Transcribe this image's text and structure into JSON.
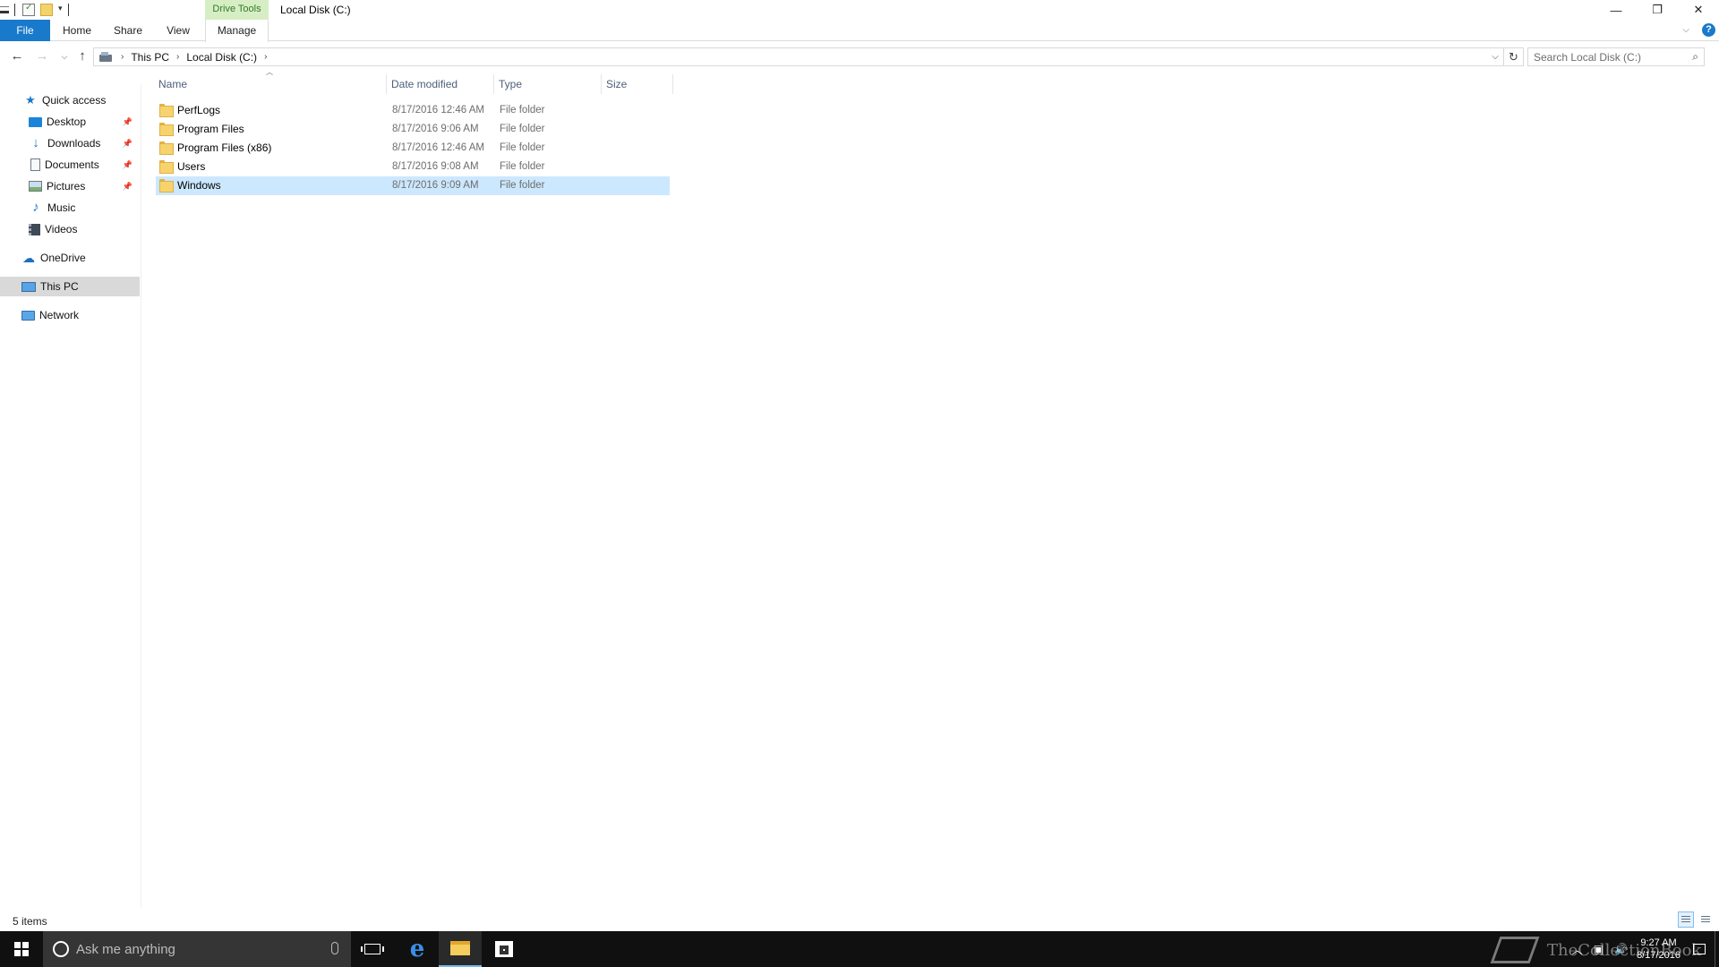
{
  "window": {
    "title": "Local Disk (C:)",
    "context_tab": "Drive Tools",
    "buttons": {
      "minimize": "—",
      "restore": "❐",
      "close": "✕"
    }
  },
  "ribbon": {
    "tabs": [
      "File",
      "Home",
      "Share",
      "View",
      "Manage"
    ],
    "help": "?"
  },
  "address": {
    "breadcrumbs": [
      "This PC",
      "Local Disk (C:)"
    ],
    "search_placeholder": "Search Local Disk (C:)"
  },
  "nav": {
    "quick_access": "Quick access",
    "items": [
      {
        "label": "Desktop",
        "icon": "desktop-icon",
        "pinned": true
      },
      {
        "label": "Downloads",
        "icon": "downloads-icon",
        "pinned": true
      },
      {
        "label": "Documents",
        "icon": "documents-icon",
        "pinned": true
      },
      {
        "label": "Pictures",
        "icon": "pictures-icon",
        "pinned": true
      },
      {
        "label": "Music",
        "icon": "music-icon",
        "pinned": false
      },
      {
        "label": "Videos",
        "icon": "videos-icon",
        "pinned": false
      }
    ],
    "onedrive": "OneDrive",
    "this_pc": "This PC",
    "network": "Network"
  },
  "columns": {
    "name": "Name",
    "date": "Date modified",
    "type": "Type",
    "size": "Size"
  },
  "files": [
    {
      "name": "PerfLogs",
      "date": "8/17/2016 12:46 AM",
      "type": "File folder",
      "size": ""
    },
    {
      "name": "Program Files",
      "date": "8/17/2016 9:06 AM",
      "type": "File folder",
      "size": ""
    },
    {
      "name": "Program Files (x86)",
      "date": "8/17/2016 12:46 AM",
      "type": "File folder",
      "size": ""
    },
    {
      "name": "Users",
      "date": "8/17/2016 9:08 AM",
      "type": "File folder",
      "size": ""
    },
    {
      "name": "Windows",
      "date": "8/17/2016 9:09 AM",
      "type": "File folder",
      "size": "",
      "selected": true
    }
  ],
  "status": {
    "count": "5 items"
  },
  "taskbar": {
    "search_placeholder": "Ask me anything",
    "watermark": "TheCollectionBook",
    "time": "9:27 AM",
    "date": "8/17/2016"
  }
}
